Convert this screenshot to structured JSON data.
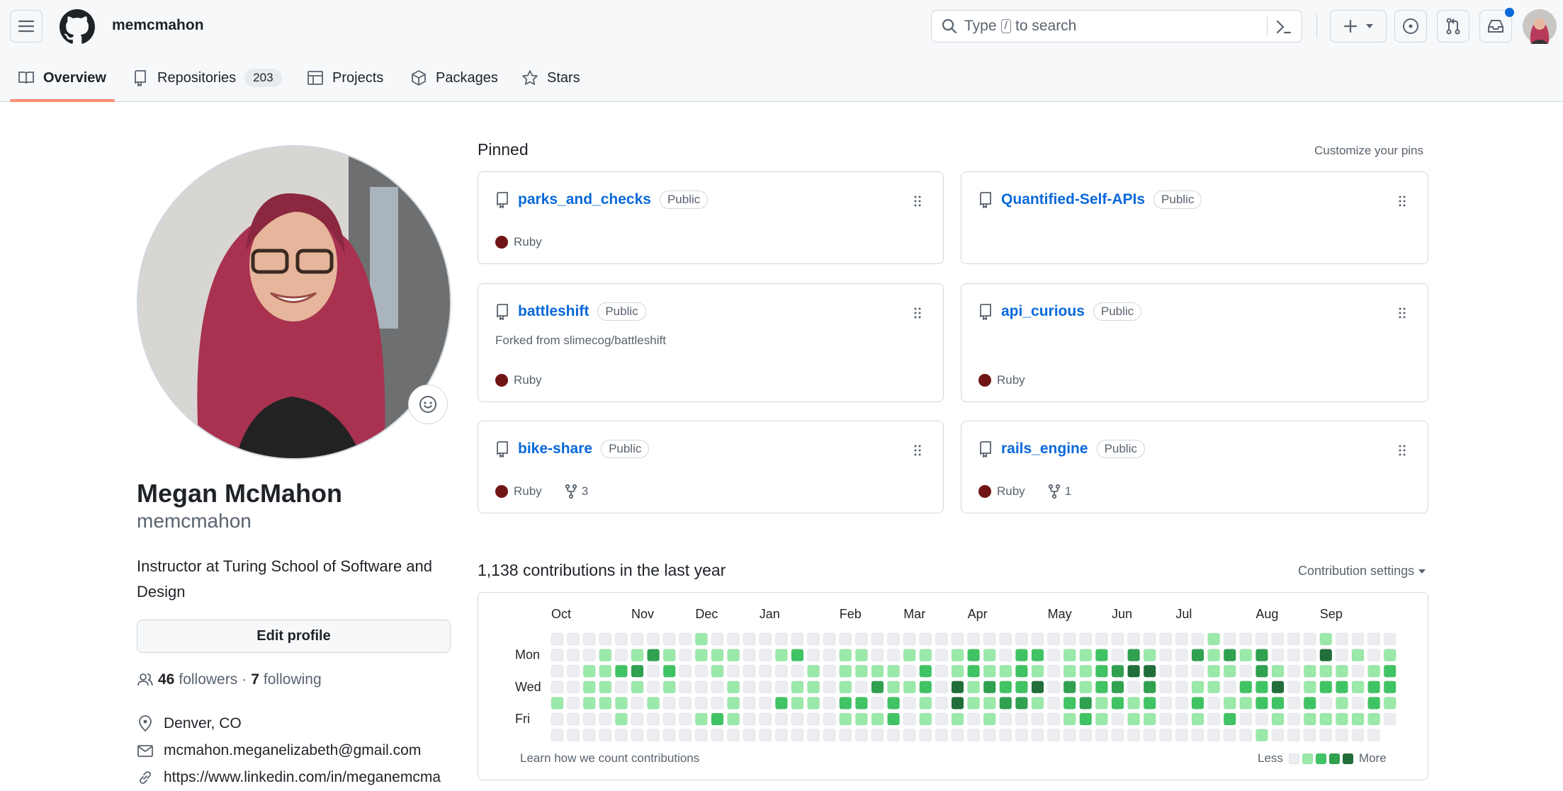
{
  "header": {
    "username": "memcmahon",
    "search_placeholder_pre": "Type",
    "search_key": "/",
    "search_placeholder_post": "to search"
  },
  "tabs": [
    {
      "label": "Overview",
      "active": true
    },
    {
      "label": "Repositories",
      "count": "203"
    },
    {
      "label": "Projects"
    },
    {
      "label": "Packages"
    },
    {
      "label": "Stars"
    }
  ],
  "profile": {
    "name": "Megan McMahon",
    "login": "memcmahon",
    "bio": "Instructor at Turing School of Software and Design",
    "edit_label": "Edit profile",
    "followers_count": "46",
    "followers_label": "followers",
    "separator": "·",
    "following_count": "7",
    "following_label": "following",
    "location": "Denver, CO",
    "email": "mcmahon.meganelizabeth@gmail.com",
    "link": "https://www.linkedin.com/in/meganemcma"
  },
  "pinned": {
    "title": "Pinned",
    "customize": "Customize your pins",
    "repos": [
      {
        "name": "parks_and_checks",
        "visibility": "Public",
        "language": "Ruby",
        "language_color": "#701516"
      },
      {
        "name": "Quantified-Self-APIs",
        "visibility": "Public"
      },
      {
        "name": "battleshift",
        "visibility": "Public",
        "forked_from": "Forked from slimecog/battleshift",
        "language": "Ruby",
        "language_color": "#701516"
      },
      {
        "name": "api_curious",
        "visibility": "Public",
        "language": "Ruby",
        "language_color": "#701516"
      },
      {
        "name": "bike-share",
        "visibility": "Public",
        "language": "Ruby",
        "language_color": "#701516",
        "forks": "3"
      },
      {
        "name": "rails_engine",
        "visibility": "Public",
        "language": "Ruby",
        "language_color": "#701516",
        "forks": "1"
      }
    ]
  },
  "contributions": {
    "settings": "Contribution settings",
    "learn": "Learn how we count contributions",
    "less": "Less",
    "more": "More"
  },
  "chart_data": {
    "type": "heatmap",
    "title": "1,138 contributions in the last year",
    "months": [
      {
        "label": "Oct",
        "week": 0
      },
      {
        "label": "Nov",
        "week": 5
      },
      {
        "label": "Dec",
        "week": 9
      },
      {
        "label": "Jan",
        "week": 13
      },
      {
        "label": "Feb",
        "week": 18
      },
      {
        "label": "Mar",
        "week": 22
      },
      {
        "label": "Apr",
        "week": 26
      },
      {
        "label": "May",
        "week": 31
      },
      {
        "label": "Jun",
        "week": 35
      },
      {
        "label": "Jul",
        "week": 39
      },
      {
        "label": "Aug",
        "week": 44
      },
      {
        "label": "Sep",
        "week": 48
      }
    ],
    "day_labels": [
      {
        "label": "Mon",
        "row": 1
      },
      {
        "label": "Wed",
        "row": 3
      },
      {
        "label": "Fri",
        "row": 5
      }
    ],
    "level_colors": [
      "#ebedf0",
      "#9be9a8",
      "#40c463",
      "#30a14e",
      "#216e39"
    ],
    "levels_by_weekday": [
      [
        0,
        0,
        0,
        0,
        0,
        0,
        0,
        0,
        0,
        1,
        0,
        0,
        0,
        0,
        0,
        0,
        0,
        0,
        0,
        0,
        0,
        0,
        0,
        0,
        0,
        0,
        0,
        0,
        0,
        0,
        0,
        0,
        0,
        0,
        0,
        0,
        0,
        0,
        0,
        0,
        0,
        1,
        0,
        0,
        0,
        0,
        0,
        0,
        1,
        0,
        0,
        0,
        0
      ],
      [
        0,
        0,
        0,
        1,
        0,
        1,
        3,
        1,
        0,
        1,
        1,
        1,
        0,
        0,
        1,
        2,
        0,
        0,
        1,
        1,
        0,
        0,
        1,
        1,
        0,
        1,
        2,
        1,
        0,
        2,
        2,
        0,
        1,
        1,
        2,
        0,
        3,
        1,
        0,
        0,
        3,
        1,
        3,
        1,
        3,
        0,
        0,
        0,
        4,
        0,
        1,
        0,
        1
      ],
      [
        0,
        0,
        1,
        1,
        2,
        3,
        0,
        2,
        0,
        0,
        1,
        0,
        0,
        0,
        0,
        0,
        1,
        0,
        1,
        1,
        1,
        1,
        0,
        2,
        0,
        1,
        2,
        1,
        1,
        2,
        1,
        0,
        1,
        1,
        2,
        3,
        4,
        4,
        0,
        0,
        0,
        1,
        1,
        0,
        3,
        1,
        0,
        1,
        1,
        1,
        0,
        1,
        2
      ],
      [
        0,
        0,
        1,
        1,
        0,
        1,
        0,
        1,
        0,
        0,
        0,
        1,
        0,
        0,
        0,
        1,
        1,
        0,
        1,
        0,
        3,
        1,
        1,
        2,
        0,
        4,
        1,
        3,
        2,
        2,
        4,
        0,
        3,
        1,
        2,
        3,
        0,
        3,
        0,
        0,
        1,
        1,
        0,
        2,
        2,
        4,
        0,
        1,
        2,
        2,
        1,
        2,
        2
      ],
      [
        1,
        0,
        1,
        1,
        1,
        0,
        1,
        0,
        0,
        0,
        0,
        1,
        0,
        0,
        2,
        1,
        1,
        0,
        2,
        2,
        0,
        2,
        0,
        1,
        0,
        4,
        1,
        1,
        3,
        3,
        1,
        0,
        2,
        3,
        1,
        2,
        1,
        2,
        0,
        0,
        2,
        0,
        1,
        1,
        2,
        2,
        0,
        2,
        0,
        1,
        0,
        2,
        1
      ],
      [
        0,
        0,
        0,
        0,
        1,
        0,
        0,
        0,
        0,
        1,
        2,
        1,
        0,
        0,
        0,
        0,
        0,
        0,
        1,
        1,
        1,
        2,
        0,
        1,
        0,
        1,
        0,
        1,
        0,
        0,
        0,
        0,
        1,
        2,
        1,
        0,
        1,
        1,
        0,
        0,
        1,
        0,
        2,
        0,
        0,
        1,
        0,
        1,
        1,
        1,
        1,
        1,
        0
      ],
      [
        0,
        0,
        0,
        0,
        0,
        0,
        0,
        0,
        0,
        0,
        0,
        0,
        0,
        0,
        0,
        0,
        0,
        0,
        0,
        0,
        0,
        0,
        0,
        0,
        0,
        0,
        0,
        0,
        0,
        0,
        0,
        0,
        0,
        0,
        0,
        0,
        0,
        0,
        0,
        0,
        0,
        0,
        0,
        0,
        1,
        0,
        0,
        0,
        0,
        0,
        0,
        0
      ]
    ]
  }
}
